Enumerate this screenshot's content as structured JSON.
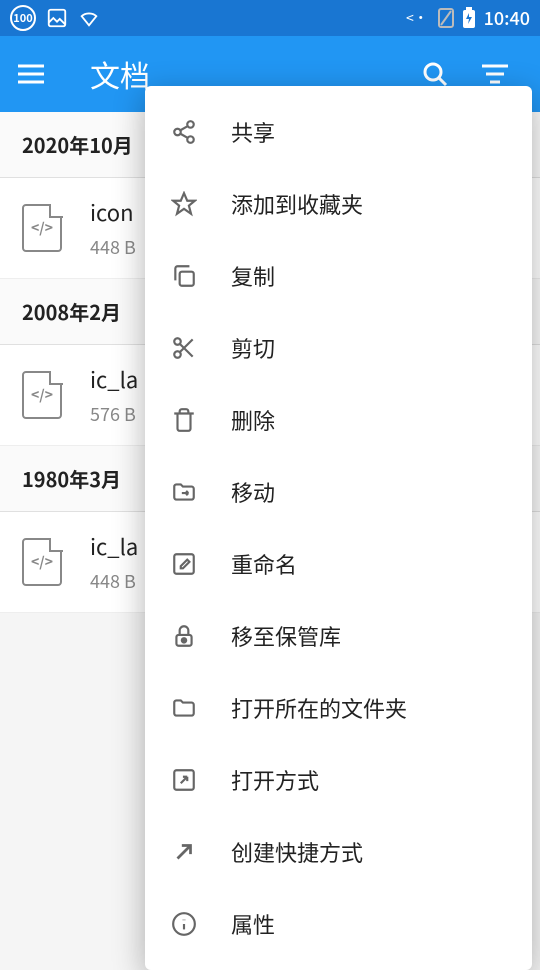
{
  "status_bar": {
    "battery_pct": "100",
    "time": "10:40"
  },
  "app_bar": {
    "title": "文档"
  },
  "sections": [
    {
      "header": "2020年10月",
      "file": {
        "name": "icon",
        "size": "448 B"
      }
    },
    {
      "header": "2008年2月",
      "file": {
        "name": "ic_la",
        "size": "576 B"
      }
    },
    {
      "header": "1980年3月",
      "file": {
        "name": "ic_la",
        "size": "448 B"
      }
    }
  ],
  "menu": {
    "share": "共享",
    "favorite": "添加到收藏夹",
    "copy": "复制",
    "cut": "剪切",
    "delete": "删除",
    "move": "移动",
    "rename": "重命名",
    "vault": "移至保管库",
    "open_folder": "打开所在的文件夹",
    "open_with": "打开方式",
    "shortcut": "创建快捷方式",
    "properties": "属性"
  }
}
